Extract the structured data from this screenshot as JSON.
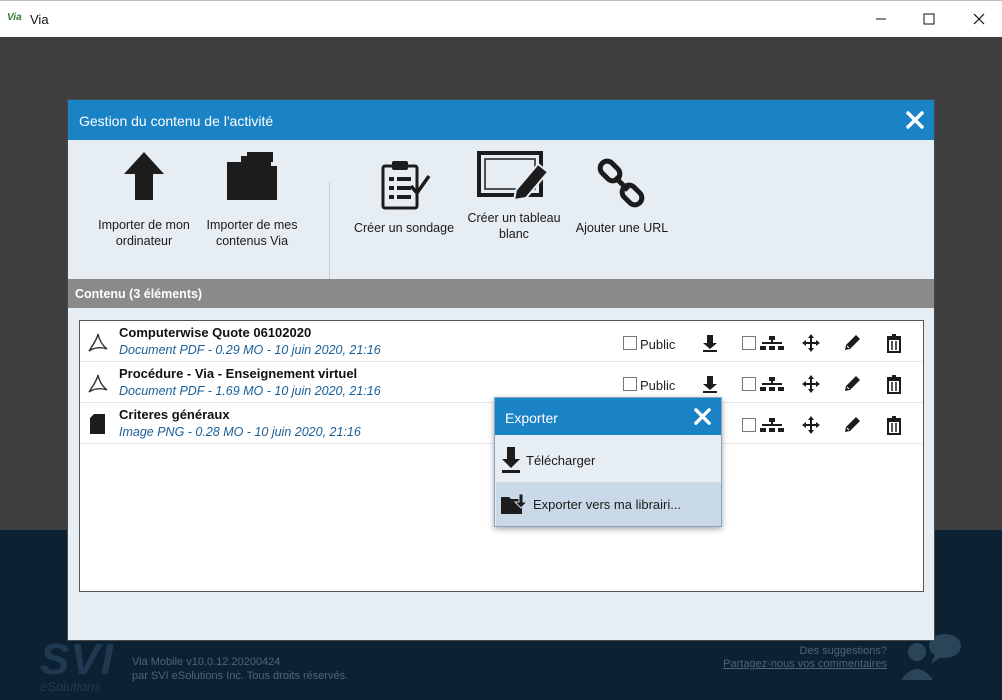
{
  "window": {
    "logo": "Via",
    "title": "Via"
  },
  "dialog": {
    "title": "Gestion du contenu de l'activité",
    "tools": [
      {
        "line1": "Importer de mon",
        "line2": "ordinateur"
      },
      {
        "line1": "Importer de mes",
        "line2": "contenus Via"
      },
      {
        "line1": "Créer un sondage",
        "line2": ""
      },
      {
        "line1": "Créer un tableau",
        "line2": "blanc"
      },
      {
        "line1": "Ajouter une URL",
        "line2": ""
      }
    ],
    "section_title": "Contenu (3 éléments)",
    "items": [
      {
        "name": "Computerwise Quote 06102020",
        "meta": "Document PDF - 0.29 MO - 10 juin 2020, 21:16",
        "public_label": "Public",
        "icon": "pdf-icon"
      },
      {
        "name": "Procédure - Via - Enseignement virtuel",
        "meta": "Document PDF - 1.69 MO - 10 juin 2020, 21:16",
        "public_label": "Public",
        "icon": "pdf-icon"
      },
      {
        "name": "Criteres généraux",
        "meta": "Image PNG - 0.28 MO - 10 juin 2020, 21:16",
        "public_label": "",
        "icon": "image-file-icon"
      }
    ]
  },
  "export_popup": {
    "title": "Exporter",
    "download_label": "Télécharger",
    "export_label": "Exporter vers ma librairi..."
  },
  "footer": {
    "logo_big": "SVI",
    "logo_small": "eSolutions",
    "version_line1": "Via Mobile v10.0.12.20200424",
    "version_line2": "par SVI eSolutions Inc. Tous droits réservés.",
    "suggest_line1": "Des suggestions?",
    "suggest_link": "Partagez-nous vos commentaires"
  },
  "colors": {
    "accent": "#1a83c6",
    "panel": "#e6edf3",
    "meta_text": "#1a5f98"
  }
}
